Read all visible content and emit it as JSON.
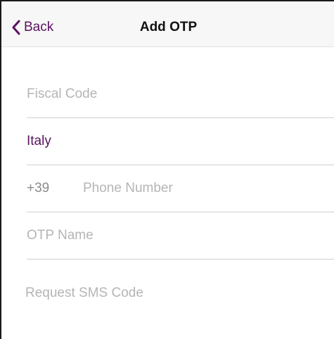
{
  "navbar": {
    "back_label": "Back",
    "title": "Add OTP",
    "back_icon": "chevron-left-icon",
    "accent_color": "#5b1260"
  },
  "form": {
    "fiscal_code": {
      "placeholder": "Fiscal Code",
      "value": ""
    },
    "country": {
      "value": "Italy"
    },
    "phone": {
      "prefix": "+39",
      "placeholder": "Phone Number",
      "value": ""
    },
    "otp_name": {
      "placeholder": "OTP Name",
      "value": ""
    },
    "request_sms_label": "Request SMS Code"
  }
}
